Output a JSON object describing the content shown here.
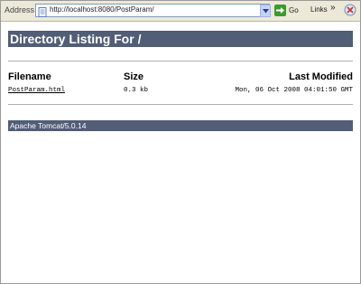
{
  "browser": {
    "address_label": "Address",
    "url": "http://localhost:8080/PostParam/",
    "go_label": "Go",
    "links_label": "Links",
    "chevron": "»"
  },
  "page": {
    "title": "Directory Listing For /",
    "columns": {
      "filename": "Filename",
      "size": "Size",
      "modified": "Last Modified"
    },
    "files": [
      {
        "name": "PostParam.html",
        "size": "0.3 kb",
        "modified": "Mon, 06 Oct 2008 04:01:50 GMT"
      }
    ],
    "footer": "Apache Tomcat/5.0.14"
  }
}
